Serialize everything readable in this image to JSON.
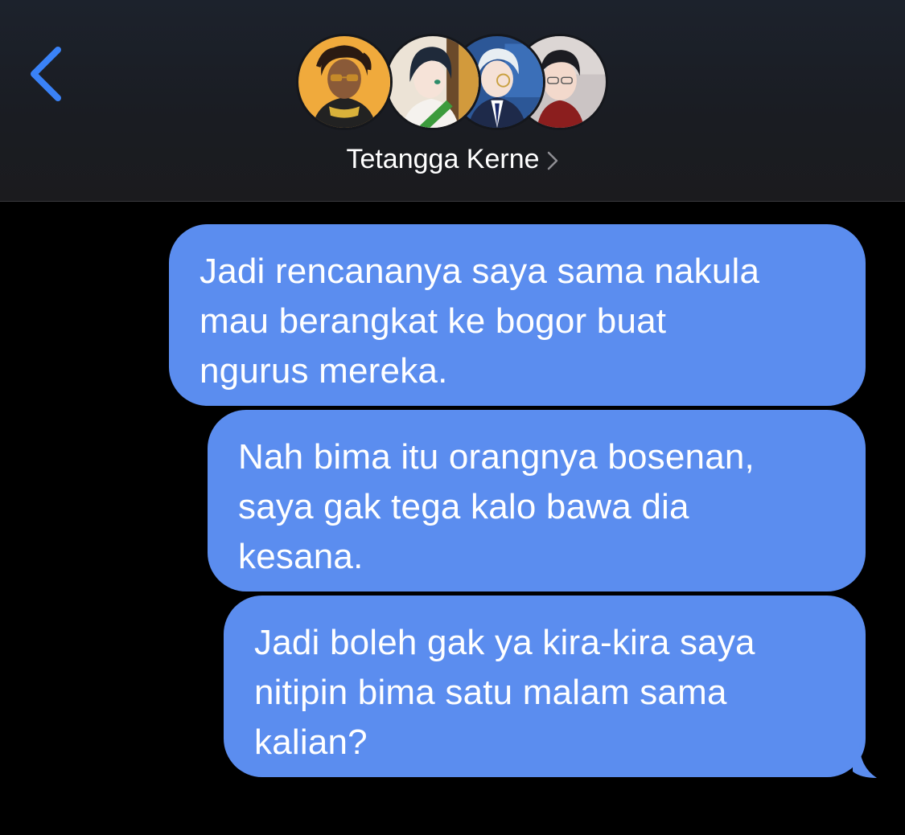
{
  "header": {
    "back_icon": "chevron-left-icon",
    "group_name": "Tetangga Kerne",
    "chevron_icon": "chevron-right-icon",
    "avatars": [
      {
        "name": "avatar-1",
        "bg": "#f0a93a"
      },
      {
        "name": "avatar-2",
        "bg": "#3d7a3a"
      },
      {
        "name": "avatar-3",
        "bg": "#2f5a9a"
      },
      {
        "name": "avatar-4",
        "bg": "#c9c3c3"
      }
    ]
  },
  "colors": {
    "accent": "#3a82f7",
    "bubble": "#5b8def",
    "background": "#000000"
  },
  "messages": [
    {
      "text": "Jadi rencananya saya sama nakula\nmau berangkat ke bogor buat\nngurus mereka."
    },
    {
      "text": "Nah bima itu orangnya bosenan,\nsaya gak tega kalo bawa dia\nkesana."
    },
    {
      "text": "Jadi boleh gak ya kira-kira saya\nnitipin bima satu malam sama\nkalian?"
    }
  ]
}
